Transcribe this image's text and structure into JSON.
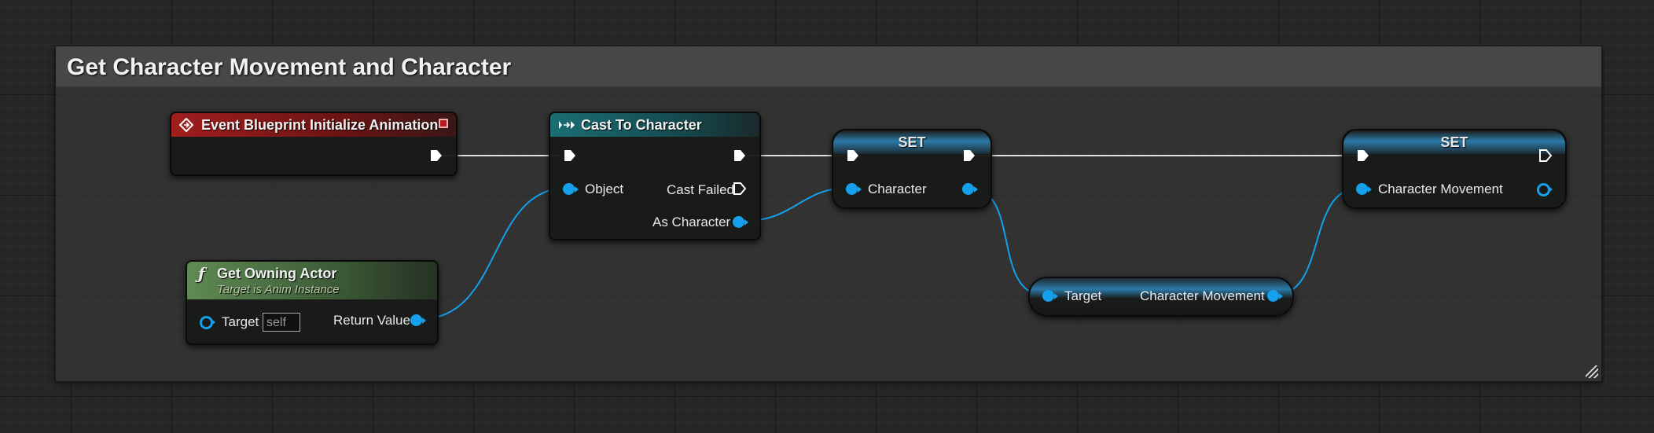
{
  "comment": {
    "title": "Get Character Movement and Character"
  },
  "event_node": {
    "title": "Event Blueprint Initialize Animation"
  },
  "cast_node": {
    "title": "Cast To Character",
    "object_label": "Object",
    "cast_failed_label": "Cast Failed",
    "as_character_label": "As Character"
  },
  "set_node_1": {
    "title": "SET",
    "character_label": "Character"
  },
  "set_node_2": {
    "title": "SET",
    "character_movement_label": "Character Movement"
  },
  "owning_actor_node": {
    "title": "Get Owning Actor",
    "subtitle": "Target is Anim Instance",
    "target_label": "Target",
    "target_default": "self",
    "return_label": "Return Value"
  },
  "movement_getter_node": {
    "target_label": "Target",
    "output_label": "Character Movement"
  },
  "colors": {
    "exec_wire": "#e0e0e0",
    "object_wire": "#14a0ec",
    "event_header": "#a11e1e",
    "cast_header": "#1b6e73",
    "function_header": "#5f8a54"
  }
}
